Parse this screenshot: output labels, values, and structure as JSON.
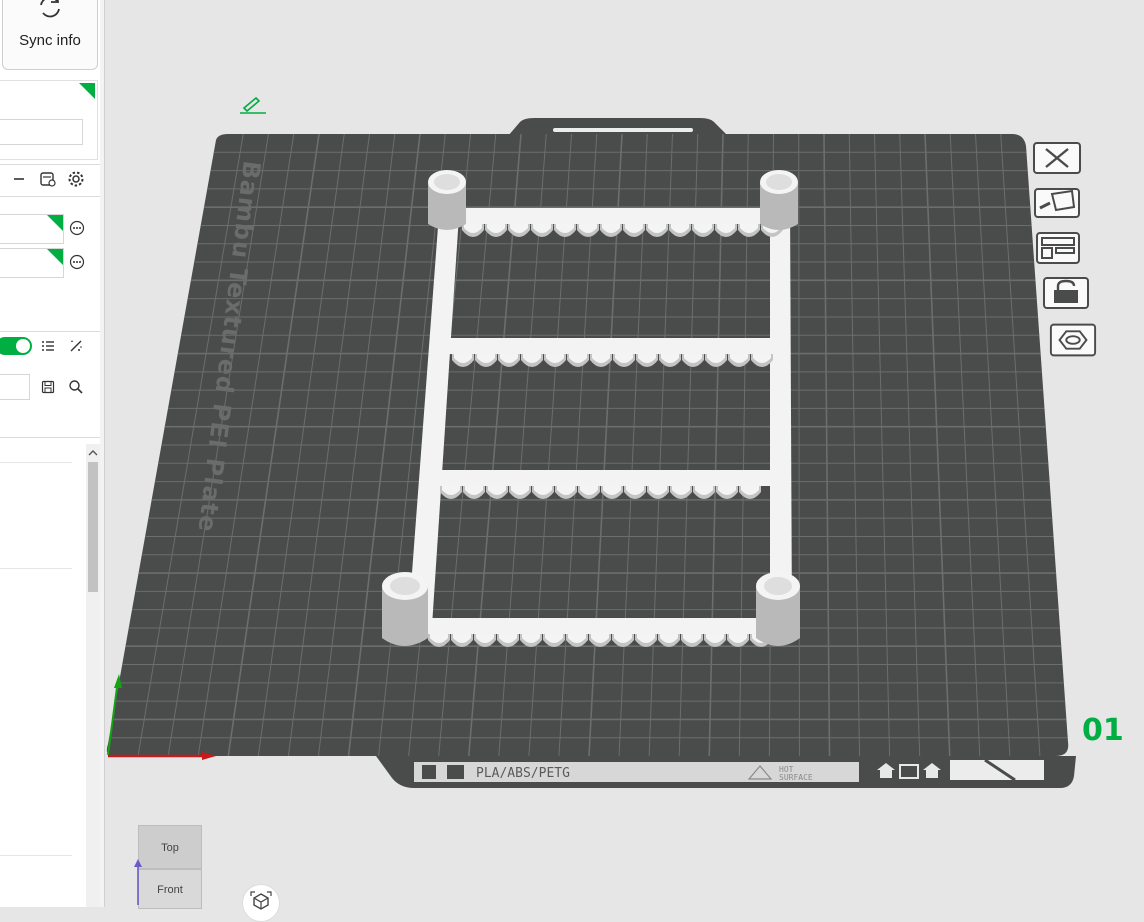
{
  "sidebar": {
    "sync_label": "Sync info",
    "field_value_1": "",
    "field_value_2": "",
    "field_value_3": "",
    "search_value": ""
  },
  "plate": {
    "name": "Bambu Textured PEI Plate",
    "material_label": "PLA/ABS/PETG",
    "hot_label_1": "HOT",
    "hot_label_2": "SURFACE",
    "number": "01"
  },
  "view_cube": {
    "top_label": "Top",
    "front_label": "Front"
  },
  "colors": {
    "accent": "#00ae42",
    "plate": "#4a4b4b",
    "grid": "#6b6c6c",
    "model": "#f4f4f4"
  },
  "icons": [
    "sync-icon",
    "minus-icon",
    "filament-settings-icon",
    "gear-icon",
    "more-icon",
    "list-icon",
    "magic-wand-icon",
    "save-icon",
    "search-icon",
    "edit-icon",
    "close-icon",
    "orient-icon",
    "arrange-icon",
    "lock-icon",
    "plate-settings-icon",
    "camera-icon"
  ]
}
